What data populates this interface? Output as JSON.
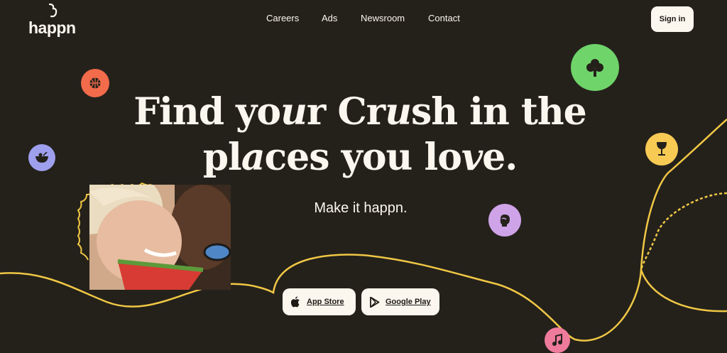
{
  "brand": {
    "name": "happn"
  },
  "nav": {
    "items": [
      {
        "label": "Careers"
      },
      {
        "label": "Ads"
      },
      {
        "label": "Newsroom"
      },
      {
        "label": "Contact"
      }
    ],
    "signin_label": "Sign in"
  },
  "hero": {
    "headline_parts": [
      "Find yo",
      "u",
      "r Cr",
      "u",
      "sh in the",
      "pl",
      "a",
      "ces you lo",
      "v",
      "e."
    ],
    "tagline": "Make it happn."
  },
  "stores": {
    "app_store": "App Store",
    "google_play": "Google Play"
  },
  "icons": [
    {
      "name": "basketball-icon",
      "color": "#f26b4b"
    },
    {
      "name": "bowl-icon",
      "color": "#9ea0ee"
    },
    {
      "name": "tree-icon",
      "color": "#6fd46a"
    },
    {
      "name": "wine-glass-icon",
      "color": "#f7ca54"
    },
    {
      "name": "boxing-glove-icon",
      "color": "#cfa3e8"
    },
    {
      "name": "music-note-icon",
      "color": "#ef7b9c"
    }
  ],
  "colors": {
    "background": "#24211b",
    "curve": "#f0c744",
    "text": "#fbf7ee"
  }
}
